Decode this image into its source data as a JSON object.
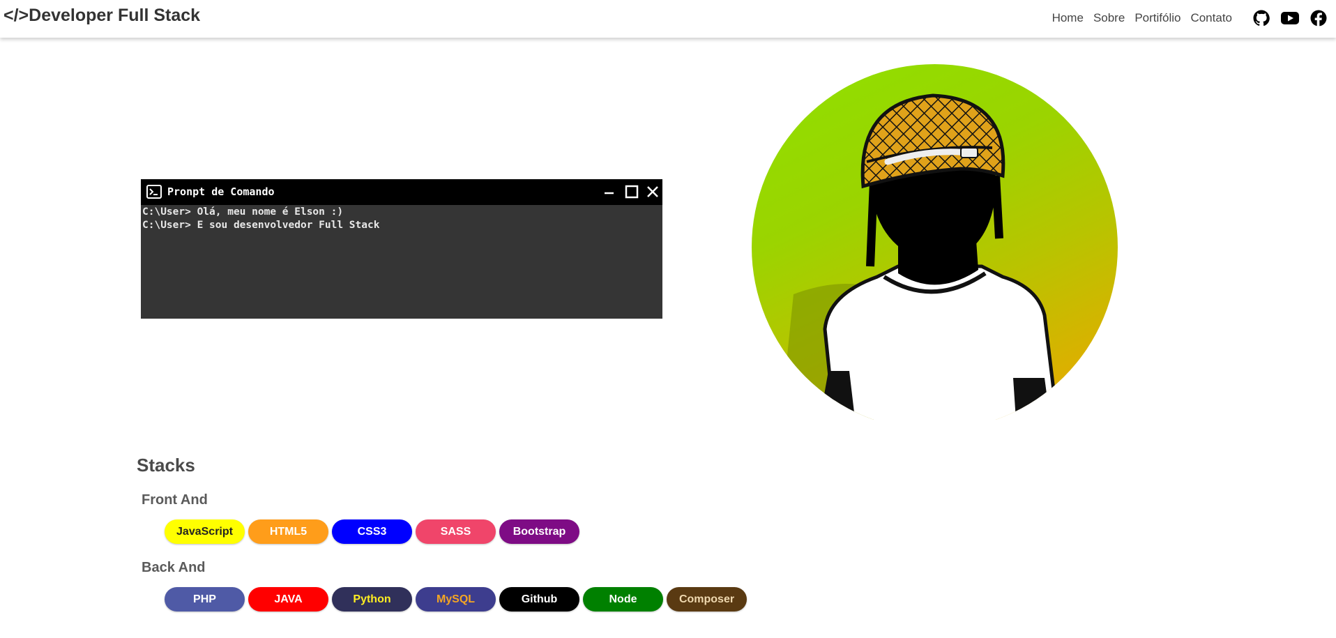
{
  "header": {
    "brand": "</>Developer Full Stack",
    "nav": [
      "Home",
      "Sobre",
      "Portifólio",
      "Contato"
    ],
    "social_icons": [
      "github-icon",
      "youtube-icon",
      "facebook-icon"
    ]
  },
  "terminal": {
    "title": "Pronpt de Comando",
    "lines": [
      "C:\\User> Olá, meu nome é Elson :)",
      "C:\\User> E sou desenvolvedor Full Stack"
    ],
    "controls": [
      "minimize-icon",
      "maximize-icon",
      "close-icon"
    ]
  },
  "stacks": {
    "title": "Stacks",
    "front": {
      "title": "Front And",
      "items": [
        {
          "label": "JavaScript",
          "bg": "#ffff00",
          "color": "#222222"
        },
        {
          "label": "HTML5",
          "bg": "#ff9d1a",
          "color": "#ffffff"
        },
        {
          "label": "CSS3",
          "bg": "#0000ff",
          "color": "#ffffff"
        },
        {
          "label": "SASS",
          "bg": "#f0456a",
          "color": "#ffffff"
        },
        {
          "label": "Bootstrap",
          "bg": "#7e0c85",
          "color": "#ffffff"
        }
      ]
    },
    "back": {
      "title": "Back And",
      "items": [
        {
          "label": "PHP",
          "bg": "#4f5aa6",
          "color": "#ffffff"
        },
        {
          "label": "JAVA",
          "bg": "#ff0000",
          "color": "#ffffff"
        },
        {
          "label": "Python",
          "bg": "#30305a",
          "color": "#ffee22"
        },
        {
          "label": "MySQL",
          "bg": "#3d3d8e",
          "color": "#f5a623"
        },
        {
          "label": "Github",
          "bg": "#000000",
          "color": "#ffffff"
        },
        {
          "label": "Node",
          "bg": "#008000",
          "color": "#ffffff"
        },
        {
          "label": "Composer",
          "bg": "#5a3a12",
          "color": "#f0d9b0"
        }
      ]
    }
  },
  "colors": {
    "terminal_body": "#353535",
    "terminal_bar": "#000000",
    "avatar_gradient_top": "#8fe000",
    "avatar_gradient_bottom": "#e0a800"
  }
}
